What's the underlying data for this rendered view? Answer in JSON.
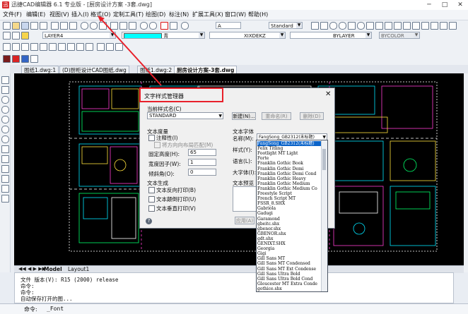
{
  "window": {
    "title": "迅捷CAD编辑器 6.1 专业版 - [厨房设计方案 -3套.dwg]",
    "logo_text": "迅",
    "controls": [
      "─",
      "□",
      "✕"
    ]
  },
  "menu": {
    "items": [
      "文件(F)",
      "编辑(E)",
      "视图(V)",
      "插入(I)",
      "格式(O)",
      "定制工具(T)",
      "绘图(D)",
      "标注(N)",
      "扩展工具(X)",
      "窗口(W)",
      "帮助(H)"
    ]
  },
  "toolbar": {
    "layer_combo": "LAYER4",
    "color_combo": "青",
    "dim_style_combo": "Standard",
    "text_style_combo": "A",
    "linetype_combo": "XIXDEKZ",
    "lineweight_combo": "BYLAYER",
    "plotstyle_combo": "BYCOLOR"
  },
  "tabs": [
    {
      "label": "图纸1.dwg:1"
    },
    {
      "label": "(D)厨柜设计CAD图纸.dwg"
    },
    {
      "label": "图纸1.dwg:2"
    },
    {
      "label": "厨房设计方案-3套.dwg"
    }
  ],
  "layout_tabs": [
    "Model",
    "Layout1"
  ],
  "command": {
    "lines": [
      "文件 版本(V): R15 (2000) release",
      "命令:",
      "命令:",
      "自动保存打开的图..."
    ],
    "prompt": "命令:",
    "input": "_Font"
  },
  "dialog": {
    "title": "文字样式管理器",
    "current_style_label": "当前样式名(C)",
    "current_style_value": "STANDARD",
    "new_button": "新建(N)...",
    "rename_button": "重命名(R)",
    "delete_button": "删除(D)",
    "text_measure_label": "文本度量",
    "annotative_label": "注释性(I)",
    "match_layout_label": "将方向向布局匹配(M)",
    "fixed_height_label": "固定高度(H):",
    "fixed_height_value": "65",
    "width_factor_label": "宽度因子(W):",
    "width_factor_value": "1",
    "oblique_label": "倾斜角(O):",
    "oblique_value": "0",
    "text_generation_label": "文本生成",
    "backwards_label": "文本反向打印(B)",
    "upside_down_label": "文本颠倒打印(U)",
    "vertical_label": "文本垂直打印(V)",
    "font_label": "文本字体",
    "font_name_label": "名称(M):",
    "font_name_value": "FangSong_GB2312(末标题)",
    "style_label": "样式(Y):",
    "language_label": "语言(L):",
    "bigfont_label": "大字体(I):",
    "preview_label": "文本预览",
    "apply_button": "应用(A)",
    "help_icon": "?"
  },
  "font_list": [
    "FangSong_GB2312(末标题)",
    "Felix Titling",
    "Footlight MT Light",
    "Forte",
    "Franklin Gothic Book",
    "Franklin Gothic Demi",
    "Franklin Gothic Demi Cond",
    "Franklin Gothic Heavy",
    "Franklin Gothic Medium",
    "Franklin Gothic Medium Co",
    "Freestyle Script",
    "French Script MT",
    "FSSR_8.SHX",
    "Gabriola",
    "Gadugi",
    "Garamond",
    "gbeitc.shx",
    "gbenor.shx",
    "GBENOR.shx",
    "gdt.shx",
    "GENIXT.SHX",
    "Georgia",
    "Gigi",
    "Gill Sans MT",
    "Gill Sans MT Condensed",
    "Gill Sans MT Ext Condense",
    "Gill Sans Ultra Bold",
    "Gill Sans Ultra Bold Cond",
    "Gloucester MT Extra Conde",
    "gothice.shx"
  ],
  "colors": {
    "highlight": "#e8202a",
    "arrow": "#e8202a",
    "selection": "#0a63c9",
    "drawing_bg": "#000000"
  }
}
